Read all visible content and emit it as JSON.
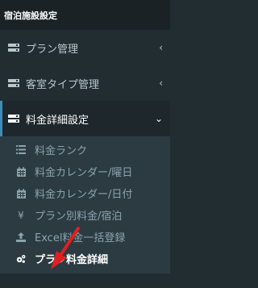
{
  "header": {
    "title": "宿泊施設設定"
  },
  "menu": [
    {
      "label": "プラン管理",
      "icon": "server-icon",
      "chevron": "‹"
    },
    {
      "label": "客室タイプ管理",
      "icon": "server-icon",
      "chevron": "‹"
    },
    {
      "label": "料金詳細設定",
      "icon": "server-icon",
      "chevron": "⌄"
    }
  ],
  "submenu": [
    {
      "label": "料金ランク",
      "icon": "list-icon"
    },
    {
      "label": "料金カレンダー/曜日",
      "icon": "calendar-icon"
    },
    {
      "label": "料金カレンダー/日付",
      "icon": "calendar-icon"
    },
    {
      "label": "プラン別料金/宿泊",
      "icon": "yen-icon",
      "glyph": "¥"
    },
    {
      "label": "Excel料金一括登録",
      "icon": "upload-icon"
    },
    {
      "label": "プラン料金詳細",
      "icon": "cogs-icon"
    }
  ],
  "colors": {
    "sidebar": "#222d32",
    "active_border": "#3c8dbc",
    "arrow": "#e02020"
  }
}
